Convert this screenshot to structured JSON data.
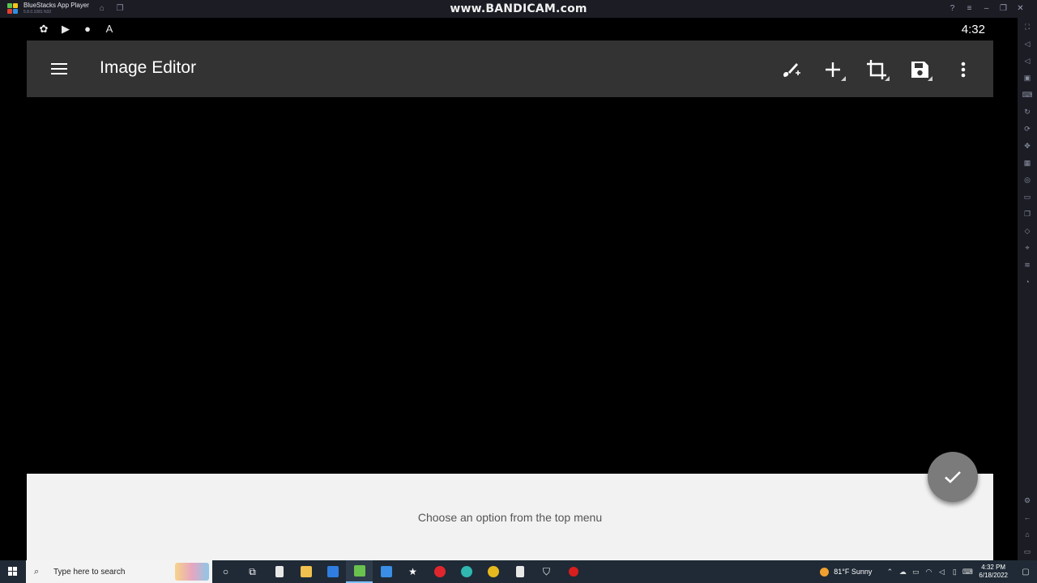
{
  "bluestacks": {
    "app_name": "BlueStacks App Player",
    "version": "5.8.0.1081 N32",
    "watermark": "www.BANDICAM.com",
    "home_icon": "home-icon",
    "multi_instance_icon": "multi-instance-icon",
    "window_controls": [
      "help-icon",
      "menu-icon",
      "minimize-icon",
      "restore-icon",
      "close-icon"
    ]
  },
  "android_status": {
    "time": "4:32",
    "icons": [
      "settings-flower-icon",
      "youtube-icon",
      "chat-bubble-icon",
      "a-letter-icon"
    ]
  },
  "appbar": {
    "title": "Image Editor",
    "actions": [
      "brush-icon",
      "add-icon",
      "crop-icon",
      "save-icon",
      "more-vert-icon"
    ],
    "background": "#333333"
  },
  "bottom_panel": {
    "hint": "Choose an option from the top menu"
  },
  "fab": {
    "icon": "check-icon",
    "color": "#7b7b7b"
  },
  "taskbar": {
    "search_placeholder": "Type here to search",
    "weather": "81°F  Sunny",
    "time": "4:32 PM",
    "date": "6/18/2022"
  }
}
